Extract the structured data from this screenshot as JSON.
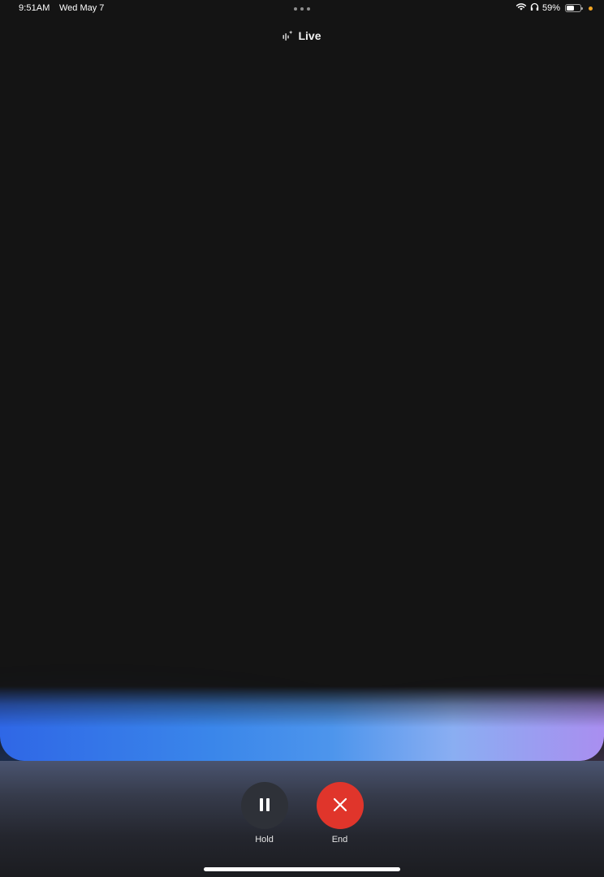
{
  "status_bar": {
    "time": "9:51AM",
    "date": "Wed May 7",
    "battery_percent": "59%",
    "battery_level": 0.59,
    "icons": [
      "wifi-icon",
      "headphones-icon",
      "battery-icon"
    ],
    "privacy_dot_color": "#f5a623"
  },
  "header": {
    "title": "Live",
    "icon": "live-sparkle-icon"
  },
  "controls": {
    "hold": {
      "label": "Hold",
      "icon": "pause-icon",
      "color": "#2e3138"
    },
    "end": {
      "label": "End",
      "icon": "close-icon",
      "color": "#e0352b"
    }
  },
  "colors": {
    "background": "#141414",
    "glow_left": "#2f67e6",
    "glow_center": "#4d95ec",
    "glow_right": "#a98ef0"
  }
}
